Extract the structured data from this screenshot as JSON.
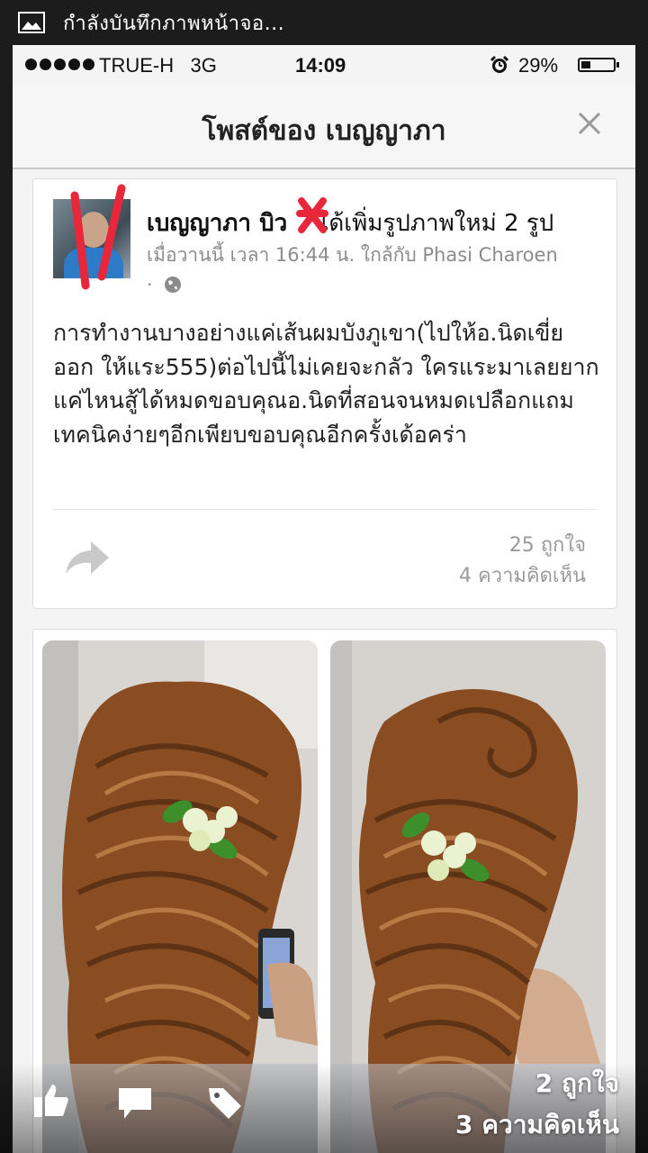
{
  "android_status": {
    "text": "กำลังบันทึกภาพหน้าจอ...",
    "icon": "image-icon"
  },
  "ios_status": {
    "carrier": "TRUE-H",
    "network": "3G",
    "time": "14:09",
    "battery": "29%"
  },
  "nav": {
    "title": "โพสต์ของ เบญญาภา",
    "close_icon": "close-icon"
  },
  "post": {
    "author_name": "เบญญาภา บิว",
    "action": "ได้เพิ่มรูปภาพใหม่ 2 รูป",
    "meta": "เมื่อวานนี้ เวลา 16:44 น. ใกล้กับ Phasi Charoen ·",
    "text": "การทำงานบางอย่างแค่เส้นผมบังภูเขา(ไปให้อ.นิดเขี่ยออก ให้แระ555)ต่อไปนี้ไม่เคยจะกลัว ใครแระมาเลยยากแค่ไหนสู้ได้หมดขอบคุณอ.นิดที่สอนจนหมดเปลือกแถมเทคนิคง่ายๆอีกเพียบขอบคุณอีกครั้งเด้อคร่า",
    "likes": "25 ถูกใจ",
    "comments": "4 ความคิดเห็น"
  },
  "photo_overlay": {
    "likes": "2 ถูกใจ",
    "comments": "3 ความคิดเห็น"
  },
  "colors": {
    "hair": "#8a4d22",
    "flower": "#eaf2d2",
    "leaf": "#3c8f2a"
  }
}
